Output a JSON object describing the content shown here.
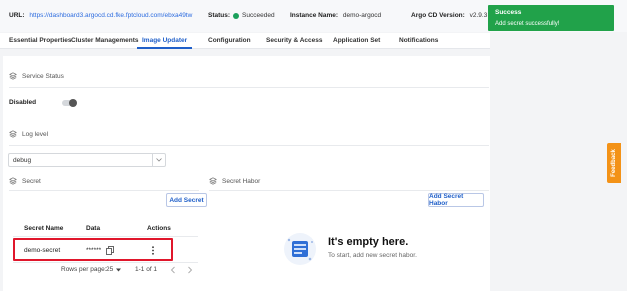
{
  "header": {
    "url_label": "URL:",
    "url_value": "https://dashboard3.argocd.cd.fke.fptcloud.com/ebxa49tw",
    "status_label": "Status:",
    "status_value": "Succeeded",
    "instance_label": "Instance Name:",
    "instance_value": "demo-argocd",
    "version_label": "Argo CD Version:",
    "version_value": "v2.9.3",
    "status_color": "#1aa05b"
  },
  "tabs": [
    {
      "label": "Essential Properties"
    },
    {
      "label": "Cluster Managements"
    },
    {
      "label": "Image Updater",
      "active": true
    },
    {
      "label": "Configuration"
    },
    {
      "label": "Security & Access"
    },
    {
      "label": "Application Set"
    },
    {
      "label": "Notifications"
    }
  ],
  "service_status": {
    "title": "Service Status",
    "toggle_label": "Disabled",
    "enabled": false
  },
  "log_level": {
    "title": "Log level",
    "selected": "debug"
  },
  "secret": {
    "title": "Secret",
    "add_button": "Add Secret",
    "columns": [
      "Secret Name",
      "Data",
      "Actions"
    ],
    "rows": [
      {
        "name": "demo-secret",
        "data": "******",
        "actions_icon": "more-vertical-icon"
      }
    ],
    "rows_per_page_label": "Rows per page:",
    "rows_per_page": "25",
    "range": "1-1 of 1"
  },
  "secret_habor": {
    "title": "Secret Habor",
    "add_button": "Add Secret Habor",
    "empty_title": "It's empty here.",
    "empty_subtitle": "To start, add new secret habor."
  },
  "toast": {
    "title": "Success",
    "message": "Add secret successfully!",
    "color": "#21a24a"
  },
  "feedback": {
    "label": "Feedback",
    "color": "#f39217"
  },
  "accent_color": "#1f5fc9"
}
